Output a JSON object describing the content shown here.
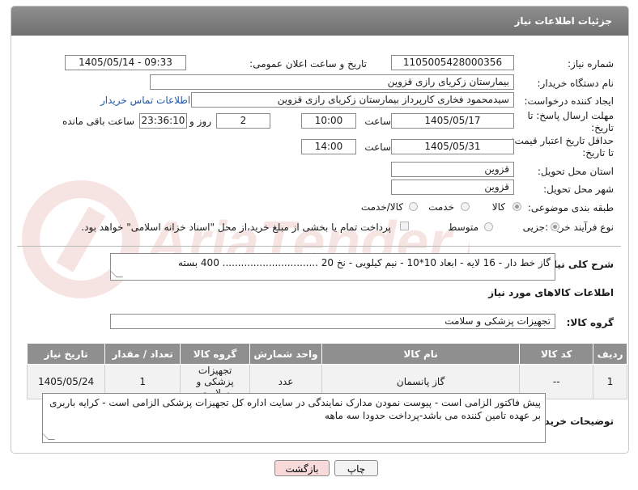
{
  "header": {
    "title": "جزئیات اطلاعات نیاز"
  },
  "watermark": {
    "text": "AriaTender.net"
  },
  "form": {
    "need_number": {
      "label": "شماره نیاز:",
      "value": "1105005428000356"
    },
    "announce_datetime": {
      "label": "تاریخ و ساعت اعلان عمومی:",
      "value": "1405/05/14 - 09:33"
    },
    "buyer_org": {
      "label": "نام دستگاه خریدار:",
      "value": "بیمارستان زکریای رازی قزوین"
    },
    "requester": {
      "label": "ایجاد کننده درخواست:",
      "value": "سیدمحمود فخاری کارپرداز بیمارستان زکریای رازی قزوین",
      "contact_link": "اطلاعات تماس خریدار"
    },
    "reply_deadline": {
      "label_line1": "مهلت ارسال پاسخ: تا",
      "label_line2": "تاریخ:",
      "date": "1405/05/17",
      "time_label": "ساعت",
      "time": "10:00",
      "days": "2",
      "days_label": "روز و",
      "remaining": "23:36:10",
      "remaining_label": "ساعت باقی مانده"
    },
    "price_validity": {
      "label_line1": "حداقل تاریخ اعتبار قیمت:",
      "label_line2": "تا تاریخ:",
      "date": "1405/05/31",
      "time_label": "ساعت",
      "time": "14:00"
    },
    "province": {
      "label": "استان محل تحویل:",
      "value": "قزوین"
    },
    "city": {
      "label": "شهر محل تحویل:",
      "value": "قزوین"
    },
    "category": {
      "label": "طبقه بندی موضوعی:",
      "options": [
        "کالا",
        "خدمت",
        "کالا/خدمت"
      ],
      "selected": 0
    },
    "process": {
      "label": "نوع فرآیند خرید :",
      "options": [
        "جزیی",
        "متوسط"
      ],
      "selected": 0,
      "payment_note": "پرداخت تمام یا بخشی از مبلغ خرید،از محل \"اسناد خزانه اسلامی\" خواهد بود."
    }
  },
  "description": {
    "label": "شرح کلی نیاز:",
    "value": "گاز خط دار  - 16 لایه  - ابعاد 10*10 - نیم کیلویی - نخ 20 ...............................  400 بسته"
  },
  "goods_section": {
    "title": "اطلاعات کالاهای مورد نیاز"
  },
  "goods_group": {
    "label": "گروه کالا:",
    "value": "تجهیزات پزشکی و سلامت"
  },
  "table": {
    "columns": [
      "ردیف",
      "کد کالا",
      "نام کالا",
      "واحد شمارش",
      "گروه کالا",
      "تعداد / مقدار",
      "تاریخ نیاز"
    ],
    "rows": [
      [
        "1",
        "--",
        "گاز پانسمان",
        "عدد",
        "تجهیزات پزشکی و سلامت",
        "1",
        "1405/05/24"
      ]
    ]
  },
  "buyer_notes": {
    "label": "توضیحات خریدار:",
    "value": "پیش فاکتور الزامی است - پیوست نمودن مدارک نمایندگی در سایت اداره کل تجهیزات پزشکی الزامی است - کرایه باربری بر عهده تامین کننده می باشد-پرداخت حدودا سه ماهه"
  },
  "buttons": {
    "print": "چاپ",
    "back": "بازگشت"
  },
  "colors": {
    "header_bg": "#7f7f7f",
    "table_header_bg": "#8f8f8f",
    "link": "#1f56a6",
    "back_button_bg": "#f8dada"
  }
}
